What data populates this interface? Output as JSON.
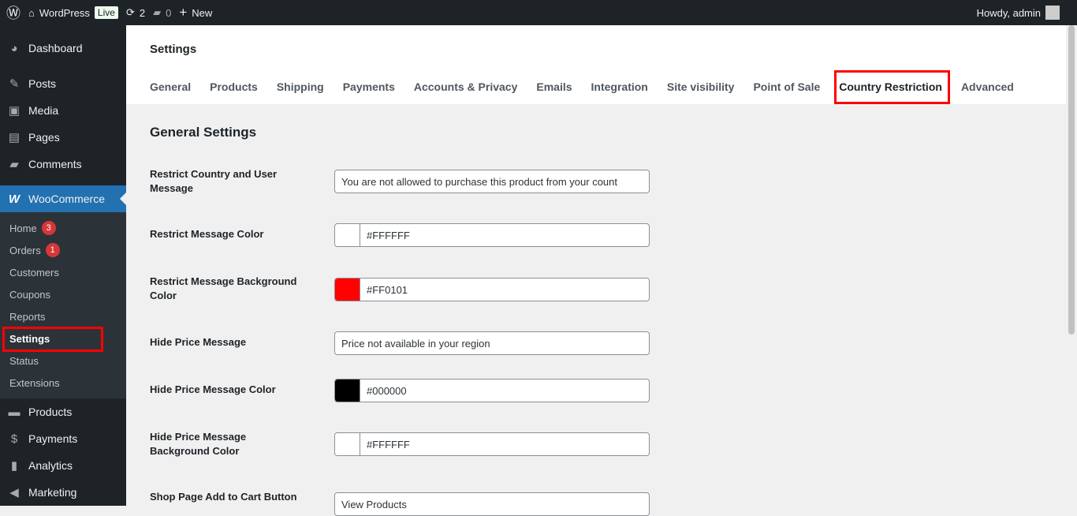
{
  "adminbar": {
    "site": "WordPress",
    "live": "Live",
    "updates": "2",
    "comments": "0",
    "new": "New",
    "howdy": "Howdy, admin"
  },
  "sidebar": {
    "top": [
      {
        "label": "Dashboard",
        "icon": "dashboard-icon"
      },
      {
        "label": "Posts",
        "icon": "pin-icon"
      },
      {
        "label": "Media",
        "icon": "media-icon"
      },
      {
        "label": "Pages",
        "icon": "pages-icon"
      },
      {
        "label": "Comments",
        "icon": "comment-icon"
      }
    ],
    "woocommerce": "WooCommerce",
    "sub": [
      {
        "label": "Home",
        "badge": "3"
      },
      {
        "label": "Orders",
        "badge": "1"
      },
      {
        "label": "Customers"
      },
      {
        "label": "Coupons"
      },
      {
        "label": "Reports"
      },
      {
        "label": "Settings"
      },
      {
        "label": "Status"
      },
      {
        "label": "Extensions"
      }
    ],
    "bottom": [
      {
        "label": "Products"
      },
      {
        "label": "Payments"
      },
      {
        "label": "Analytics"
      },
      {
        "label": "Marketing"
      }
    ]
  },
  "page": {
    "title": "Settings",
    "tabs": [
      "General",
      "Products",
      "Shipping",
      "Payments",
      "Accounts & Privacy",
      "Emails",
      "Integration",
      "Site visibility",
      "Point of Sale",
      "Country Restriction",
      "Advanced"
    ],
    "active_tab": "Country Restriction",
    "section": "General Settings",
    "fields": [
      {
        "label": "Restrict Country and User Message",
        "value": "You are not allowed to purchase this product from your count"
      },
      {
        "label": "Restrict Message Color",
        "value": "#FFFFFF",
        "swatch": "#FFFFFF"
      },
      {
        "label": "Restrict Message Background Color",
        "value": "#FF0101",
        "swatch": "#FF0101"
      },
      {
        "label": "Hide Price Message",
        "value": "Price not available in your region"
      },
      {
        "label": "Hide Price Message Color",
        "value": "#000000",
        "swatch": "#000000"
      },
      {
        "label": "Hide Price Message Background Color",
        "value": "#FFFFFF",
        "swatch": "#FFFFFF"
      },
      {
        "label": "Shop Page Add to Cart Button",
        "value": "View Products"
      }
    ]
  }
}
